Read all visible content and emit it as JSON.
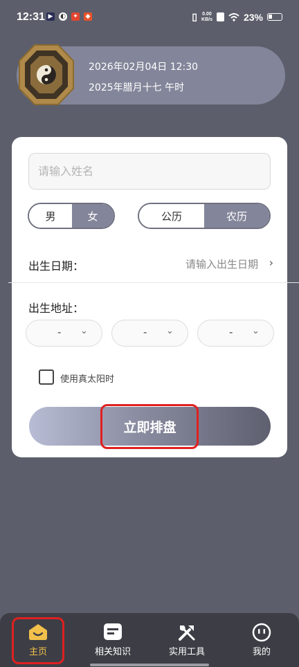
{
  "status_bar": {
    "time": "12:31",
    "app_icons": [
      "video-app",
      "browser-app",
      "app-red-1",
      "app-red-2"
    ],
    "net_speed_value": "0.00",
    "net_speed_unit": "KB/s",
    "battery": "23%"
  },
  "banner": {
    "solar_datetime": "2026年02月04日 12:30",
    "lunar_datetime": "2025年腊月十七 午时"
  },
  "form": {
    "name_placeholder": "请输入姓名",
    "name_value": "",
    "gender_options": [
      "男",
      "女"
    ],
    "gender_selected": "女",
    "calendar_options": [
      "公历",
      "农历"
    ],
    "calendar_selected": "农历",
    "birth_date_label": "出生日期：",
    "birth_date_placeholder": "请输入出生日期",
    "birth_place_label": "出生地址：",
    "place_selects": [
      "-",
      "-",
      "-"
    ],
    "true_solar_label": "使用真太阳时",
    "true_solar_checked": false,
    "submit_label": "立即排盘"
  },
  "bottom_nav": {
    "items": [
      {
        "label": "主页",
        "icon": "home-smile-icon",
        "active": true
      },
      {
        "label": "相关知识",
        "icon": "document-icon",
        "active": false
      },
      {
        "label": "实用工具",
        "icon": "tools-icon",
        "active": false
      },
      {
        "label": "我的",
        "icon": "profile-smile-icon",
        "active": false
      }
    ]
  },
  "colors": {
    "background": "#5c5f6b",
    "accent": "#83869a",
    "active_nav": "#f2c14b",
    "highlight": "#e02020"
  }
}
